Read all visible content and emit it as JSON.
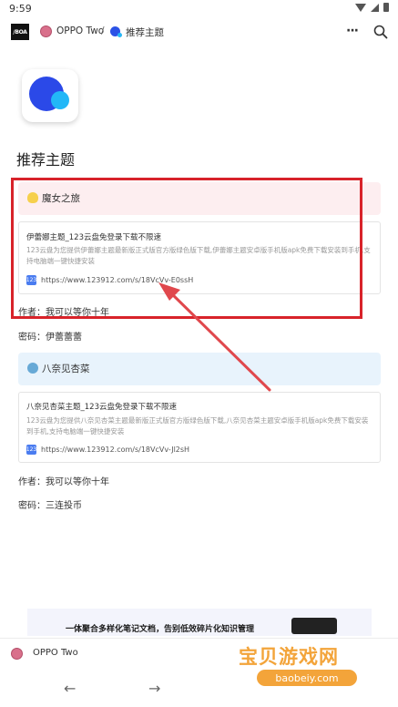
{
  "status_bar": {
    "time": "9:59"
  },
  "header": {
    "logo_text": "/BOA",
    "breadcrumb_parent": "OPPO Two",
    "breadcrumb_separator": "/",
    "breadcrumb_current": "推荐主题",
    "more_label": "···"
  },
  "page": {
    "title": "推荐主题"
  },
  "sections": [
    {
      "callout": "魔女之旅",
      "card": {
        "title": "伊蕾娜主题_123云盘免登录下载不限速",
        "description": "123云盘为您提供伊蕾娜主题最新版正式版官方版绿色版下载,伊蕾娜主题安卓版手机版apk免费下载安装到手机,支持电脑端一键快捷安装",
        "site_icon_text": "123",
        "url": "https://www.123912.com/s/18VcVv-E0ssH"
      },
      "author": "作者：我可以等你十年",
      "password": "密码：伊蕾蕾蕾"
    },
    {
      "callout": "八奈见杏菜",
      "card": {
        "title": "八奈见杏菜主题_123云盘免登录下载不限速",
        "description": "123云盘为您提供八奈见杏菜主题最新版正式版官方版绿色版下载,八奈见杏菜主题安卓版手机版apk免费下载安装到手机,支持电脑端一键快捷安装",
        "site_icon_text": "123",
        "url": "https://www.123912.com/s/18VcVv-Jl2sH"
      },
      "author": "作者：我可以等你十年",
      "password": "密码：三连投币"
    }
  ],
  "ad": {
    "text": "一体聚合多样化笔记文档，告别低效碎片化知识管理"
  },
  "bottom_bar": {
    "label": "OPPO Two"
  },
  "nav": {
    "back": "←",
    "forward": "→"
  },
  "watermark": {
    "title": "宝贝游戏网",
    "domain": "baobeiy.com"
  },
  "colors": {
    "highlight": "#d8232a",
    "pink_callout": "#fdeef0",
    "blue_callout": "#e8f3fc",
    "accent_blue": "#2b49e8"
  }
}
